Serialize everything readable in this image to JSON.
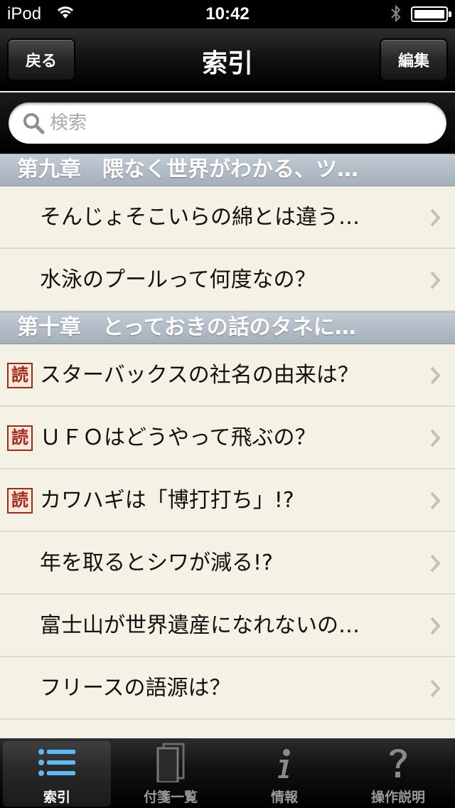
{
  "status_bar": {
    "carrier": "iPod",
    "time": "10:42"
  },
  "nav": {
    "back_label": "戻る",
    "title": "索引",
    "edit_label": "編集"
  },
  "search": {
    "placeholder": "検索",
    "value": ""
  },
  "sections": [
    {
      "header": "第九章　隈なく世界がわかる、ツ…",
      "items": [
        {
          "label": "そんじょそこいらの綿とは違う…",
          "badge": ""
        },
        {
          "label": "水泳のプールって何度なの？",
          "badge": ""
        }
      ]
    },
    {
      "header": "第十章　とっておきの話のタネに…",
      "items": [
        {
          "label": "スターバックスの社名の由来は？",
          "badge": "読"
        },
        {
          "label": "ＵＦＯはどうやって飛ぶの？",
          "badge": "読"
        },
        {
          "label": "カワハギは「博打打ち」!?",
          "badge": "読"
        },
        {
          "label": "年を取るとシワが減る!?",
          "badge": ""
        },
        {
          "label": "富士山が世界遺産になれないの…",
          "badge": ""
        },
        {
          "label": "フリースの語源は？",
          "badge": ""
        }
      ]
    }
  ],
  "tabs": [
    {
      "label": "索引",
      "icon": "list-icon",
      "active": true
    },
    {
      "label": "付箋一覧",
      "icon": "notes-icon",
      "active": false
    },
    {
      "label": "情報",
      "icon": "info-icon",
      "active": false
    },
    {
      "label": "操作説明",
      "icon": "help-icon",
      "active": false
    }
  ],
  "colors": {
    "badge_red": "#a52a1c",
    "section_header": "#b3bcc6",
    "list_background": "#f4f2e4"
  }
}
